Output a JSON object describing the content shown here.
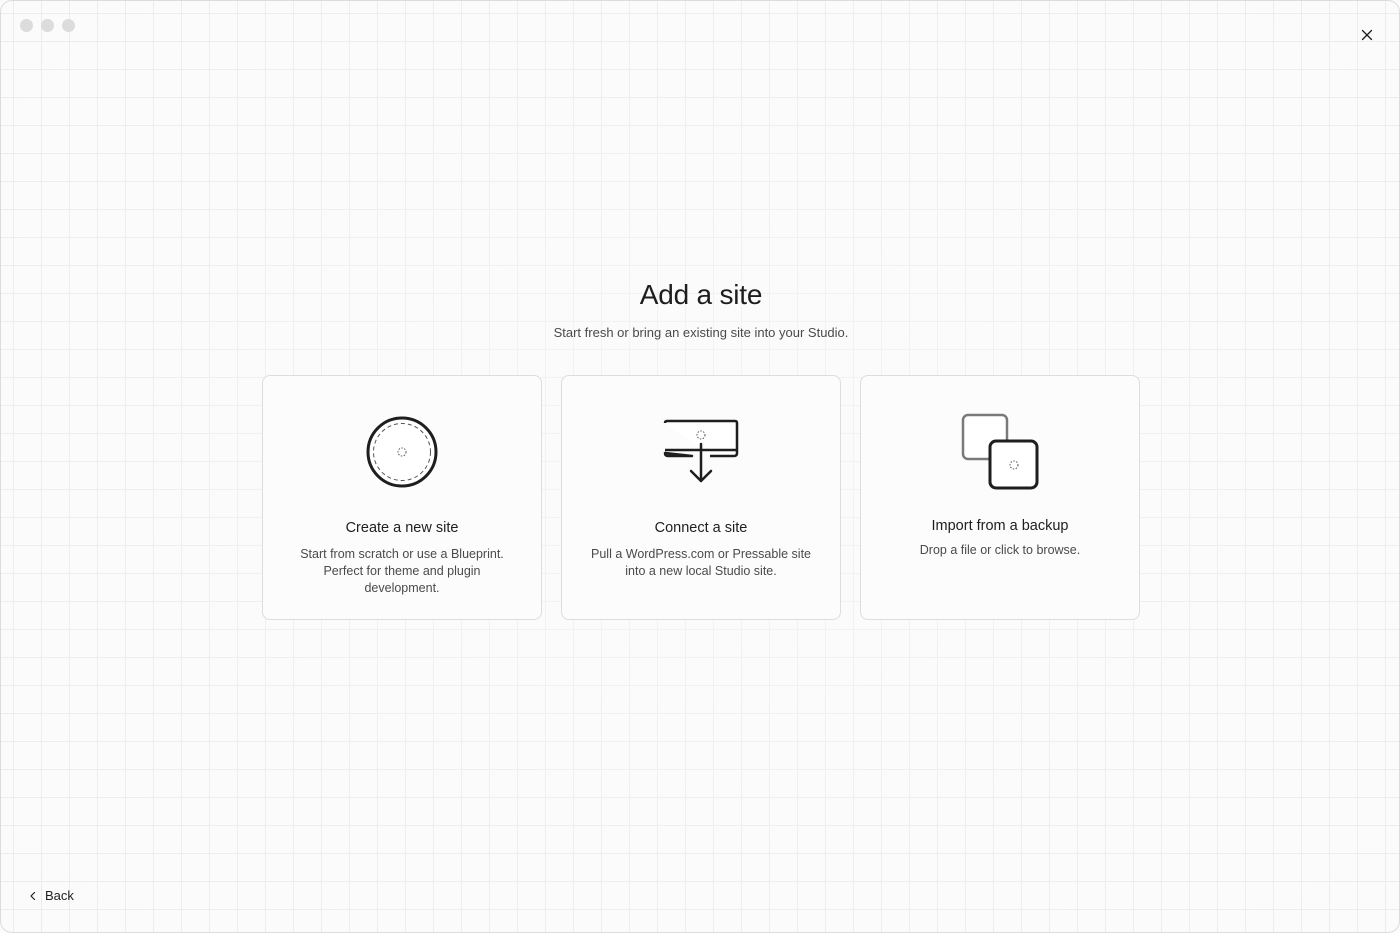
{
  "window": {
    "traffic_lights": [
      "close",
      "minimize",
      "zoom"
    ]
  },
  "header": {
    "title": "Add a site",
    "subtitle": "Start fresh or bring an existing site into your Studio."
  },
  "cards": [
    {
      "icon": "globe-circle-icon",
      "title": "Create a new site",
      "description": "Start from scratch or use a Blueprint. Perfect for theme and plugin development."
    },
    {
      "icon": "download-box-icon",
      "title": "Connect a site",
      "description": "Pull a WordPress.com or Pressable site into a new local Studio site."
    },
    {
      "icon": "stacked-squares-icon",
      "title": "Import from a backup",
      "description": "Drop a file or click to browse."
    }
  ],
  "footer": {
    "back_label": "Back"
  },
  "colors": {
    "background": "#fbfbfb",
    "grid": "#ececec",
    "card_border": "#dddddd",
    "text": "#1e1e1e",
    "muted_text": "#4a4a4a"
  }
}
